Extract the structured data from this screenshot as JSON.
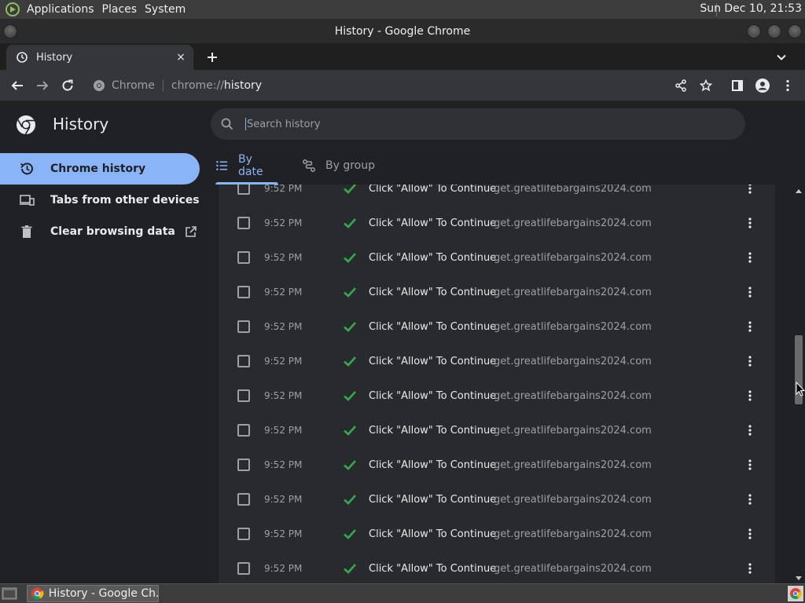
{
  "top_panel": {
    "menus": [
      "Applications",
      "Places",
      "System"
    ],
    "clock": "Sun Dec 10, 21:53"
  },
  "window": {
    "title": "History - Google Chrome"
  },
  "tab": {
    "title": "History",
    "close_glyph": "×"
  },
  "toolbar": {
    "origin_label": "Chrome",
    "url_scheme": "chrome://",
    "url_host": "history"
  },
  "page": {
    "title": "History",
    "search_placeholder": "Search history"
  },
  "sidebar": {
    "items": [
      {
        "label": "Chrome history",
        "active": true
      },
      {
        "label": "Tabs from other devices",
        "active": false
      },
      {
        "label": "Clear browsing data",
        "active": false
      }
    ]
  },
  "mode_tabs": {
    "by_date": "By date",
    "by_group": "By group"
  },
  "history": {
    "rows": [
      {
        "time": "9:52 PM",
        "title": "Click \"Allow\" To Continue",
        "domain": "get.greatlifebargains2024.com"
      },
      {
        "time": "9:52 PM",
        "title": "Click \"Allow\" To Continue",
        "domain": "get.greatlifebargains2024.com"
      },
      {
        "time": "9:52 PM",
        "title": "Click \"Allow\" To Continue",
        "domain": "get.greatlifebargains2024.com"
      },
      {
        "time": "9:52 PM",
        "title": "Click \"Allow\" To Continue",
        "domain": "get.greatlifebargains2024.com"
      },
      {
        "time": "9:52 PM",
        "title": "Click \"Allow\" To Continue",
        "domain": "get.greatlifebargains2024.com"
      },
      {
        "time": "9:52 PM",
        "title": "Click \"Allow\" To Continue",
        "domain": "get.greatlifebargains2024.com"
      },
      {
        "time": "9:52 PM",
        "title": "Click \"Allow\" To Continue",
        "domain": "get.greatlifebargains2024.com"
      },
      {
        "time": "9:52 PM",
        "title": "Click \"Allow\" To Continue",
        "domain": "get.greatlifebargains2024.com"
      },
      {
        "time": "9:52 PM",
        "title": "Click \"Allow\" To Continue",
        "domain": "get.greatlifebargains2024.com"
      },
      {
        "time": "9:52 PM",
        "title": "Click \"Allow\" To Continue",
        "domain": "get.greatlifebargains2024.com"
      },
      {
        "time": "9:52 PM",
        "title": "Click \"Allow\" To Continue",
        "domain": "get.greatlifebargains2024.com"
      },
      {
        "time": "9:52 PM",
        "title": "Click \"Allow\" To Continue",
        "domain": "get.greatlifebargains2024.com"
      }
    ]
  },
  "taskbar": {
    "task_label": "History - Google Ch..."
  },
  "colors": {
    "accent": "#8ab4f8",
    "favicon_check": "#34a853",
    "background": "#202124",
    "list_background": "#292a2d"
  }
}
